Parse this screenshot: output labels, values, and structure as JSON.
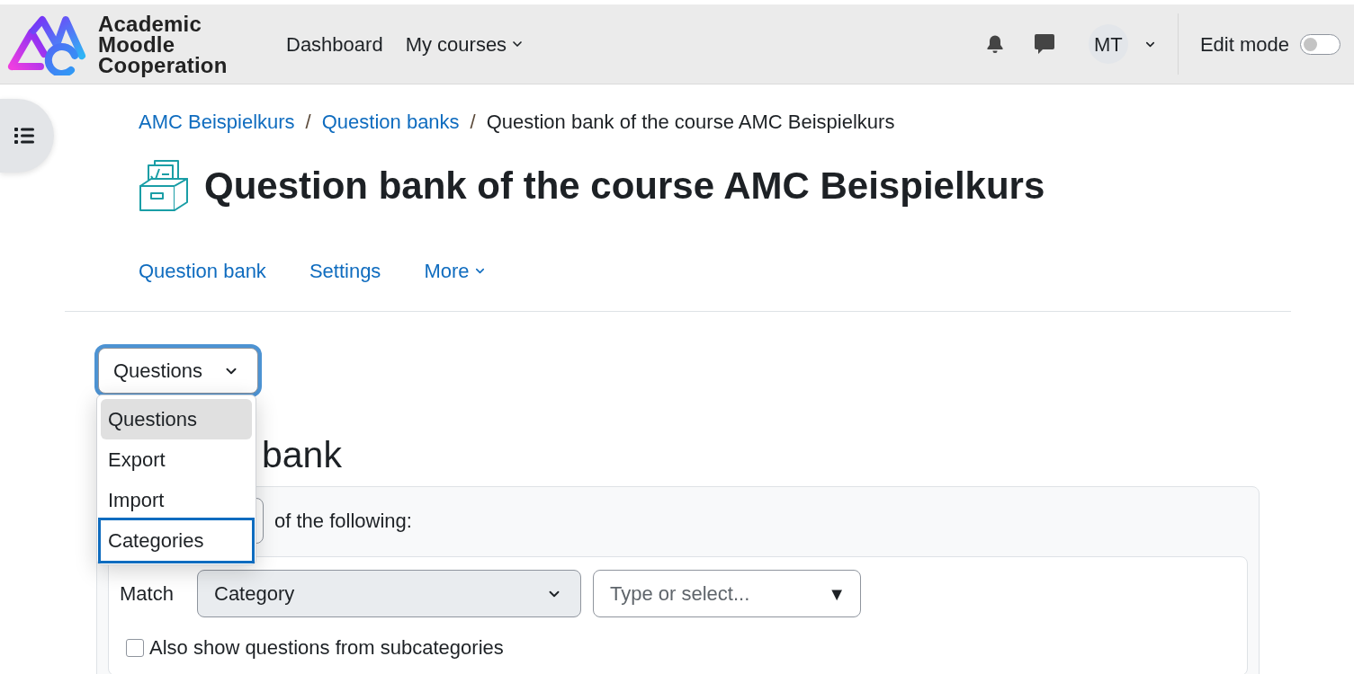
{
  "header": {
    "logo_text": [
      "Academic",
      "Moodle",
      "Cooperation"
    ],
    "nav": [
      {
        "label": "Dashboard",
        "dropdown": false
      },
      {
        "label": "My courses",
        "dropdown": true
      }
    ],
    "user_initials": "MT",
    "edit_mode": {
      "label": "Edit mode",
      "on": false
    }
  },
  "breadcrumb": [
    {
      "kind": "link",
      "label": "AMC Beispielkurs"
    },
    {
      "kind": "separator",
      "label": "/"
    },
    {
      "kind": "link",
      "label": "Question banks"
    },
    {
      "kind": "separator",
      "label": "/"
    },
    {
      "kind": "current",
      "label": "Question bank of the course AMC Beispielkurs"
    }
  ],
  "title": "Question bank of the course AMC Beispielkurs",
  "secondary_nav": [
    {
      "label": "Question bank",
      "dropdown": false
    },
    {
      "label": "Settings",
      "dropdown": false
    },
    {
      "label": "More",
      "dropdown": true
    }
  ],
  "page_select": {
    "value": "Questions",
    "expanded": true,
    "options": [
      {
        "label": "Questions",
        "selected": true,
        "focused": false
      },
      {
        "label": "Export",
        "selected": false,
        "focused": false
      },
      {
        "label": "Import",
        "selected": false,
        "focused": false
      },
      {
        "label": "Categories",
        "selected": false,
        "focused": true
      }
    ]
  },
  "section_heading": "bank",
  "filter": {
    "condition_suffix": "of the following:",
    "match_label": "Match",
    "match_select": "Category",
    "value_field": {
      "placeholder": "Type or select...",
      "arrow": "▼"
    },
    "subcategories": {
      "label": "Also show questions from subcategories",
      "checked": false
    }
  }
}
